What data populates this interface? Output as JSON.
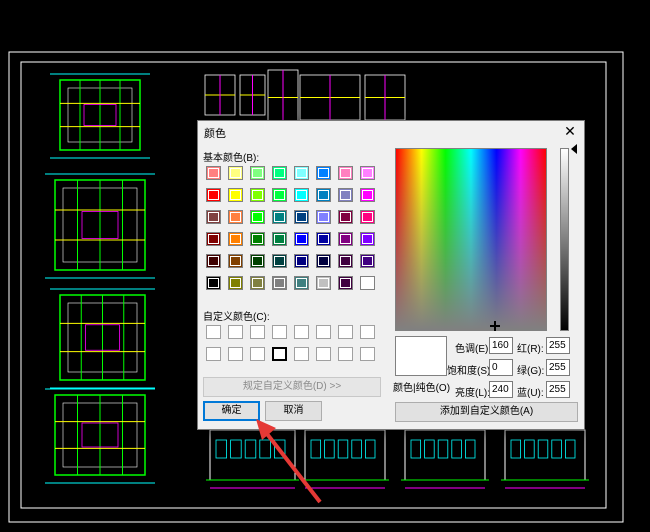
{
  "dialog": {
    "title": "颜色",
    "close_glyph": "✕",
    "basic_colors_label": "基本颜色(B):",
    "custom_colors_label": "自定义颜色(C):",
    "define_custom_button": "规定自定义颜色(D) >>",
    "ok_button": "确定",
    "cancel_button": "取消",
    "color_solid_label": "颜色|纯色(O)",
    "add_to_custom_button": "添加到自定义颜色(A)",
    "hue_label": "色调(E):",
    "hue_value": "160",
    "sat_label": "饱和度(S):",
    "sat_value": "0",
    "lum_label": "亮度(L):",
    "lum_value": "240",
    "red_label": "红(R):",
    "red_value": "255",
    "green_label": "绿(G):",
    "green_value": "255",
    "blue_label": "蓝(U):",
    "blue_value": "255",
    "selected_color": "#ffffff"
  },
  "basic_colors": [
    [
      "#ff8080",
      "#ffff80",
      "#80ff80",
      "#00ff80",
      "#80ffff",
      "#0080ff",
      "#ff80c0",
      "#ff80ff"
    ],
    [
      "#ff0000",
      "#ffff00",
      "#80ff00",
      "#00ff40",
      "#00ffff",
      "#0080c0",
      "#8080c0",
      "#ff00ff"
    ],
    [
      "#804040",
      "#ff8040",
      "#00ff00",
      "#008080",
      "#004080",
      "#8080ff",
      "#800040",
      "#ff0080"
    ],
    [
      "#800000",
      "#ff8000",
      "#008000",
      "#008040",
      "#0000ff",
      "#0000a0",
      "#800080",
      "#8000ff"
    ],
    [
      "#400000",
      "#804000",
      "#004000",
      "#004040",
      "#000080",
      "#000040",
      "#400040",
      "#400080"
    ],
    [
      "#000000",
      "#808000",
      "#808040",
      "#808080",
      "#408080",
      "#c0c0c0",
      "#400040",
      "#ffffff"
    ]
  ],
  "custom_colors": [
    [
      "#ffffff",
      "#ffffff",
      "#ffffff",
      "#ffffff",
      "#ffffff",
      "#ffffff",
      "#ffffff",
      "#ffffff"
    ],
    [
      "#ffffff",
      "#ffffff",
      "#ffffff",
      "#ffffff",
      "#ffffff",
      "#ffffff",
      "#ffffff",
      "#ffffff"
    ]
  ],
  "annotation": {
    "arrow_color": "#e53935"
  }
}
